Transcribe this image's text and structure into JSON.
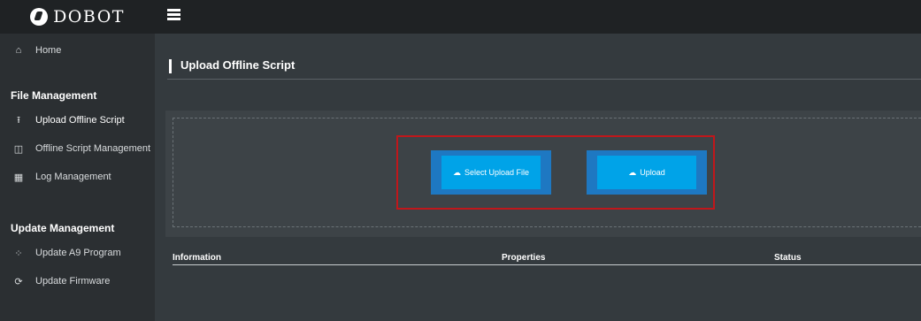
{
  "brand": {
    "name": "DOBOT"
  },
  "sidebar": {
    "home": {
      "label": "Home",
      "icon": "home-icon"
    },
    "file_management": {
      "title": "File Management",
      "items": [
        {
          "label": "Upload Offline Script",
          "icon": "upload-icon"
        },
        {
          "label": "Offline Script Management",
          "icon": "calendar-icon"
        },
        {
          "label": "Log Management",
          "icon": "calendar-grid-icon"
        }
      ]
    },
    "update_management": {
      "title": "Update Management",
      "items": [
        {
          "label": "Update A9 Program",
          "icon": "spinner-icon"
        },
        {
          "label": "Update Firmware",
          "icon": "refresh-icon"
        }
      ]
    }
  },
  "page": {
    "title": "Upload Offline Script"
  },
  "upload": {
    "select_label": "Select Upload File",
    "upload_label": "Upload",
    "button_color": "#00a3e8",
    "highlight_color": "#c0171b"
  },
  "table": {
    "columns": [
      "Information",
      "Properties",
      "Status"
    ]
  }
}
